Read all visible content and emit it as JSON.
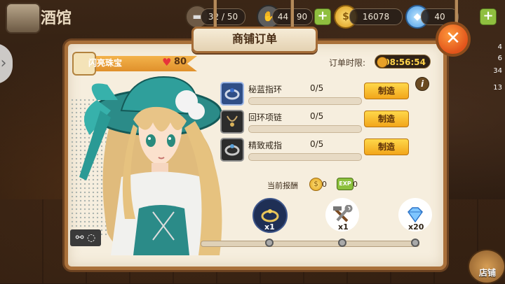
{
  "topbar": {
    "location_title": "酒馆",
    "stamina": "32 / 50",
    "capacity": "44 / 90",
    "gold": "16078",
    "diamonds": "40"
  },
  "side_badges": [
    "4",
    "6",
    "34",
    "13"
  ],
  "dialog": {
    "title": "商铺订单",
    "gem_name": "闪亮珠宝",
    "gem_affection": "80",
    "deadline_label": "订单时限:",
    "deadline_value": "08:56:54",
    "orders": [
      {
        "name": "秘蓝指环",
        "count": "0/5",
        "progress": 0,
        "button": "制造",
        "selected": true
      },
      {
        "name": "回环项链",
        "count": "0/5",
        "progress": 0,
        "button": "制造",
        "selected": false
      },
      {
        "name": "精致戒指",
        "count": "0/5",
        "progress": 0,
        "button": "制造",
        "selected": false
      }
    ],
    "reward_label": "当前报酬",
    "reward_gold": "0",
    "reward_exp": "0",
    "exp_badge": "EXP",
    "milestones": [
      {
        "label": "x1",
        "icon": "ring-icon",
        "active": true
      },
      {
        "label": "x1",
        "icon": "tools-icon",
        "active": false
      },
      {
        "label": "x20",
        "icon": "diamond-icon",
        "active": false
      }
    ],
    "milestone_progress": 0
  },
  "shop_button": "店铺",
  "colors": {
    "accent": "#f2a51a",
    "panel": "#f6eede",
    "frame": "#a9703a",
    "close": "#e2541b"
  }
}
